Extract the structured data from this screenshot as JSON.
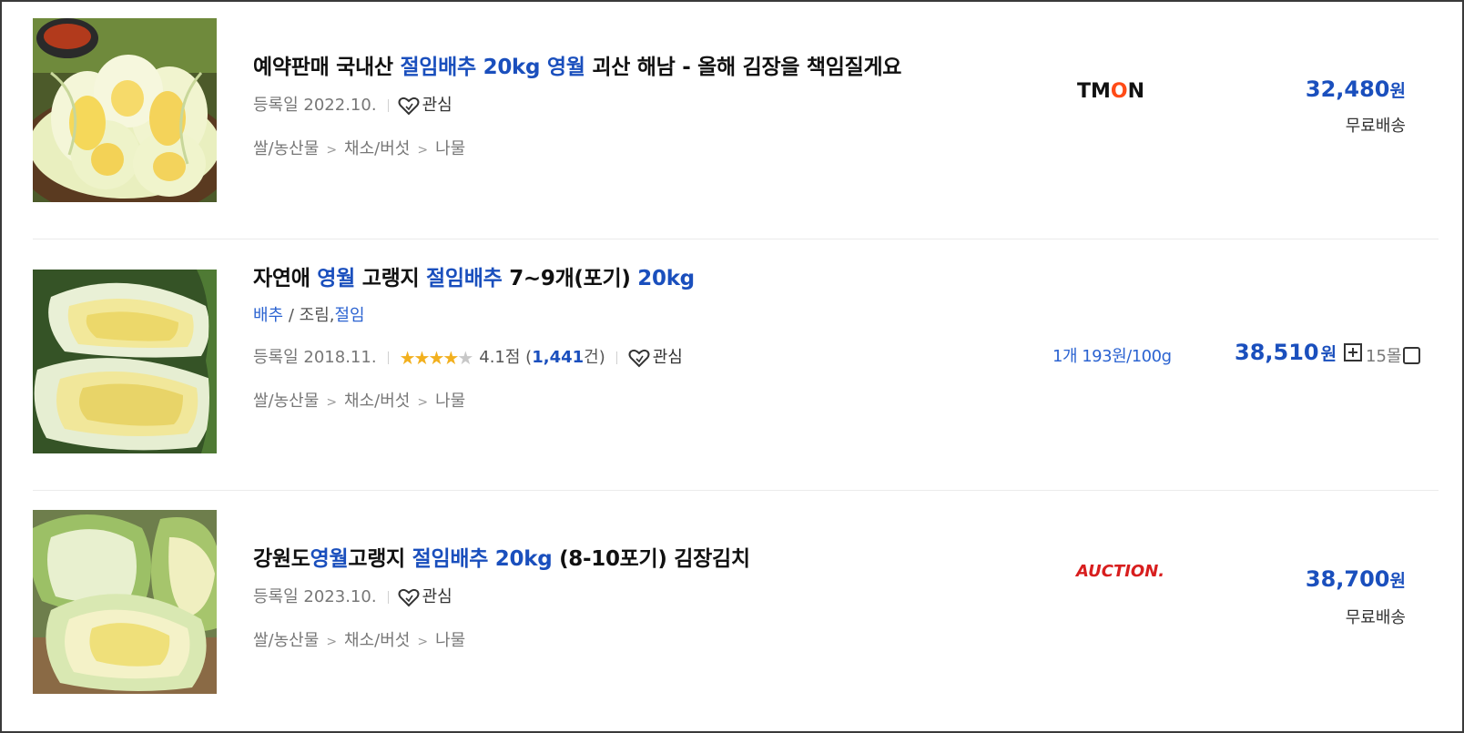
{
  "items": [
    {
      "title_parts": [
        {
          "text": "예약판매 국내산 ",
          "hl": false
        },
        {
          "text": "절임배추",
          "hl": true
        },
        {
          "text": " ",
          "hl": false
        },
        {
          "text": "20kg",
          "hl": true
        },
        {
          "text": " ",
          "hl": false
        },
        {
          "text": "영월",
          "hl": true
        },
        {
          "text": " 괴산 해남 - 올해 김장을 책임질게요",
          "hl": false
        }
      ],
      "reg_date": "등록일 2022.10.",
      "zzim_label": "관심",
      "category": [
        "쌀/농산물",
        "채소/버섯",
        "나물"
      ],
      "mall": "TMON",
      "price": "32,480",
      "currency": "원",
      "shipping": "무료배송"
    },
    {
      "title_parts": [
        {
          "text": "자연애 ",
          "hl": false
        },
        {
          "text": "영월",
          "hl": true
        },
        {
          "text": " 고랭지 ",
          "hl": false
        },
        {
          "text": "절임배추",
          "hl": true
        },
        {
          "text": " 7~9개(포기) ",
          "hl": false
        },
        {
          "text": "20kg",
          "hl": true
        }
      ],
      "tags": {
        "first": "배추",
        "sep": " / ",
        "second": "조림,",
        "third": "절임"
      },
      "reg_date": "등록일 2018.11.",
      "rating": {
        "stars": 4.1,
        "score_text": "4.1점",
        "count_open": "(",
        "count": "1,441",
        "count_close": "건)"
      },
      "zzim_label": "관심",
      "category": [
        "쌀/농산물",
        "채소/버섯",
        "나물"
      ],
      "unit_price": "1개 193원/100g",
      "price": "38,510",
      "currency": "원",
      "mall_count": "15몰"
    },
    {
      "title_parts": [
        {
          "text": "강원도",
          "hl": false
        },
        {
          "text": "영월",
          "hl": true
        },
        {
          "text": "고랭지 ",
          "hl": false
        },
        {
          "text": "절임배추",
          "hl": true
        },
        {
          "text": " ",
          "hl": false
        },
        {
          "text": "20kg",
          "hl": true
        },
        {
          "text": " (8-10포기) 김장김치",
          "hl": false
        }
      ],
      "reg_date": "등록일 2023.10.",
      "zzim_label": "관심",
      "category": [
        "쌀/농산물",
        "채소/버섯",
        "나물"
      ],
      "mall": "AUCTION.",
      "price": "38,700",
      "currency": "원",
      "shipping": "무료배송"
    }
  ],
  "colors": {
    "highlight": "#1a4fbd",
    "tmon_o": "#ff4b17",
    "auction": "#d81e1e"
  },
  "icons": {
    "zzim": "heart-outline-icon",
    "compare": "plus-box-icon",
    "select": "checkbox-icon",
    "star": "star-icon"
  }
}
